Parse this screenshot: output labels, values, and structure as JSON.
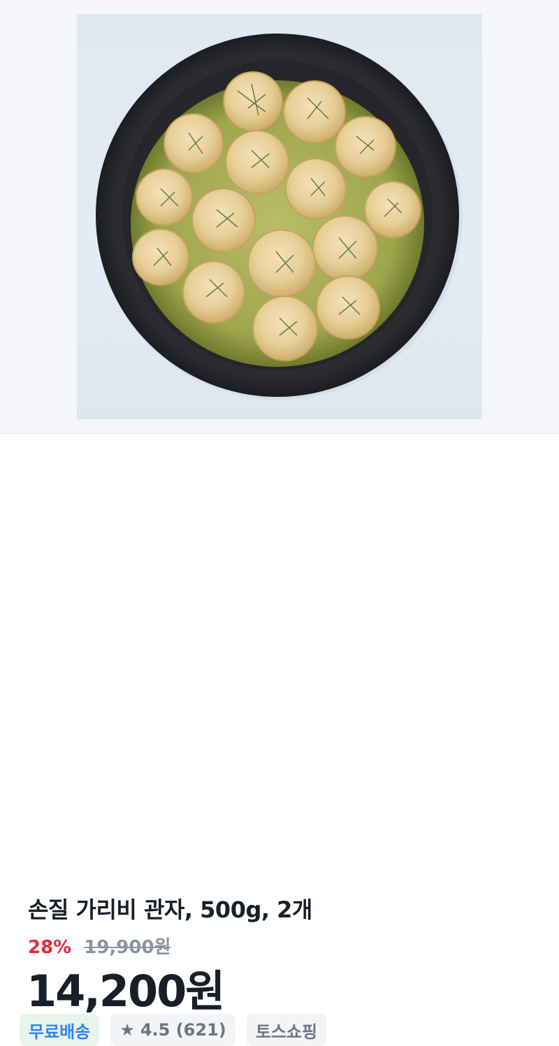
{
  "product": {
    "image_alt": "Scallops in a dark pan with dill",
    "title": "손질 가리비 관자, 500g, 2개",
    "discount": "28%",
    "original_price": "19,900원",
    "price": "14,200원"
  },
  "tags": {
    "shipping": "무료배송",
    "rating": "4.5 (621)",
    "store": "토스쇼핑"
  },
  "icons": {
    "rating": "star-icon"
  },
  "colors": {
    "discount": "#e42939",
    "free_shipping_text": "#3182f6",
    "free_shipping_bg": "#e8f5ec",
    "tag_bg": "#f2f4f6"
  }
}
